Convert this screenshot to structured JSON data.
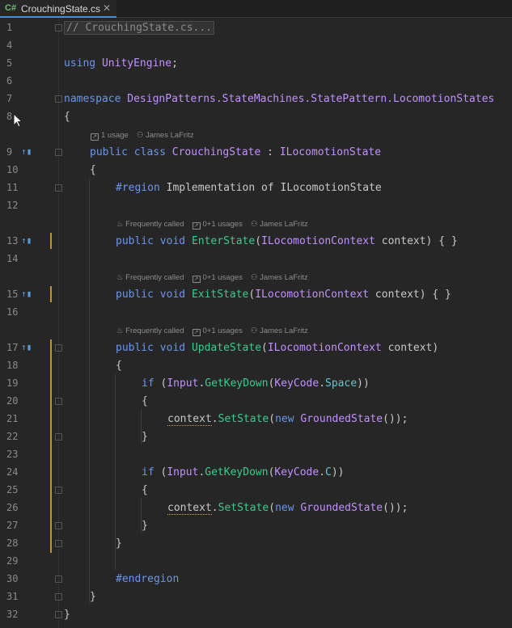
{
  "tab": {
    "lang": "C#",
    "file": "CrouchingState.cs",
    "close": "✕"
  },
  "hints": {
    "usage1": "1 usage",
    "author": "James LaFritz",
    "freq": "Frequently called",
    "usages": "0+1 usages"
  },
  "lines": {
    "n1": "1",
    "n4": "4",
    "n5": "5",
    "n6": "6",
    "n7": "7",
    "n8": "8",
    "n9": "9",
    "n10": "10",
    "n11": "11",
    "n12": "12",
    "n13": "13",
    "n14": "14",
    "n15": "15",
    "n16": "16",
    "n17": "17",
    "n18": "18",
    "n19": "19",
    "n20": "20",
    "n21": "21",
    "n22": "22",
    "n23": "23",
    "n24": "24",
    "n25": "25",
    "n26": "26",
    "n27": "27",
    "n28": "28",
    "n29": "29",
    "n30": "30",
    "n31": "31",
    "n32": "32"
  },
  "code": {
    "l1": "// CrouchingState.cs...",
    "using": "using",
    "unityengine": "UnityEngine",
    "semi": ";",
    "namespace": "namespace",
    "ns": "DesignPatterns.StateMachines.StatePattern.LocomotionStates",
    "brace_open": "{",
    "brace_close": "}",
    "public": "public",
    "class": "class",
    "crouching": "CrouchingState",
    "colon": " : ",
    "iloco": "ILocomotionState",
    "region": "#region",
    "region_text": " Implementation of ILocomotionState",
    "void": "void",
    "enter": "EnterState",
    "exit": "ExitState",
    "update": "UpdateState",
    "ictx": "ILocomotionContext",
    "ctx_param": " context) { }",
    "ctx_param2": " context)",
    "lparen": "(",
    "if": "if",
    "input": "Input",
    "getkeydown": "GetKeyDown",
    "keycode": "KeyCode",
    "space": "Space",
    "c": "C",
    "close2": "))",
    "context": "context",
    "setstate": "SetState",
    "new": "new",
    "grounded": "GroundedState",
    "end_call": "());",
    "dot": ".",
    "sp": " ",
    "endregion": "#endregion"
  }
}
